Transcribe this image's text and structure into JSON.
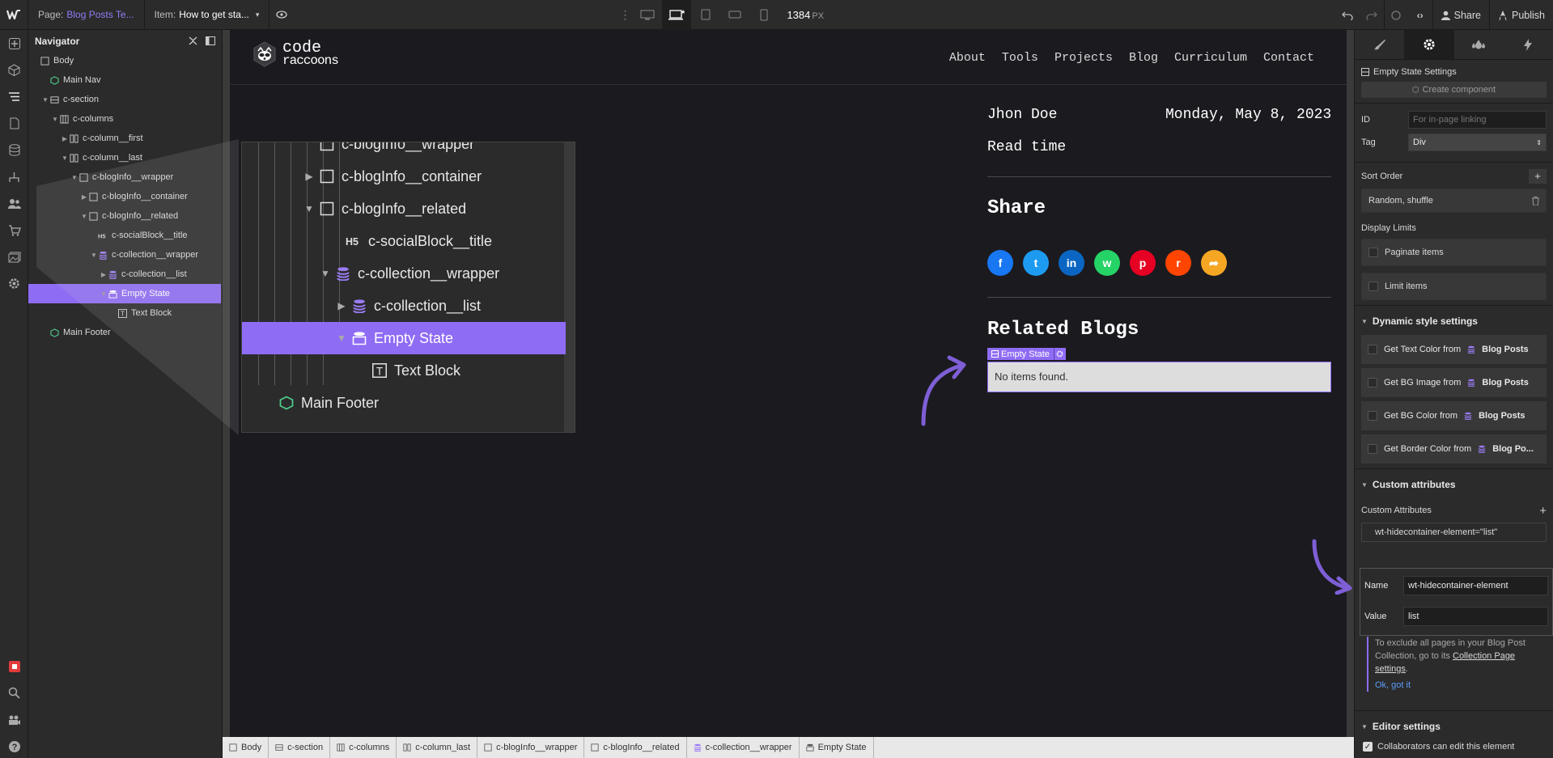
{
  "topbar": {
    "page_label": "Page:",
    "page_value": "Blog Posts Te...",
    "item_label": "Item:",
    "item_value": "How to get sta...",
    "canvas_width": "1384",
    "canvas_unit": "PX",
    "share_label": "Share",
    "publish_label": "Publish"
  },
  "navigator": {
    "title": "Navigator",
    "tree": [
      {
        "label": "Body",
        "icon": "box-icon"
      },
      {
        "label": "Main Nav",
        "icon": "component-icon"
      },
      {
        "label": "c-section",
        "icon": "section-icon"
      },
      {
        "label": "c-columns",
        "icon": "columns-icon"
      },
      {
        "label": "c-column__first",
        "icon": "column-icon"
      },
      {
        "label": "c-column__last",
        "icon": "column-icon"
      },
      {
        "label": "c-blogInfo__wrapper",
        "icon": "box-icon"
      },
      {
        "label": "c-blogInfo__container",
        "icon": "box-icon"
      },
      {
        "label": "c-blogInfo__related",
        "icon": "box-icon"
      },
      {
        "label": "c-socialBlock__title",
        "icon": "h5-icon"
      },
      {
        "label": "c-collection__wrapper",
        "icon": "collection-icon"
      },
      {
        "label": "c-collection__list",
        "icon": "collection-icon"
      },
      {
        "label": "Empty State",
        "icon": "empty-state-icon"
      },
      {
        "label": "Text Block",
        "icon": "text-block-icon"
      },
      {
        "label": "Main Footer",
        "icon": "component-icon"
      }
    ],
    "zoom_rows": [
      {
        "label": "c-blogInfo__wrapper"
      },
      {
        "label": "c-blogInfo__container"
      },
      {
        "label": "c-blogInfo__related"
      },
      {
        "label": "c-socialBlock__title"
      },
      {
        "label": "c-collection__wrapper"
      },
      {
        "label": "c-collection__list"
      },
      {
        "label": "Empty State"
      },
      {
        "label": "Text Block"
      },
      {
        "label": "Main Footer"
      }
    ]
  },
  "site": {
    "logo_top": "code",
    "logo_bottom": "raccoons",
    "links": [
      "About",
      "Tools",
      "Projects",
      "Blog",
      "Curriculum",
      "Contact"
    ],
    "author": "Jhon Doe",
    "date": "Monday, May 8, 2023",
    "read_time": "Read time",
    "share_title": "Share",
    "share_icons": [
      {
        "name": "facebook-icon",
        "glyph": "f",
        "color": "#1877f2"
      },
      {
        "name": "twitter-icon",
        "glyph": "t",
        "color": "#1d9bf0"
      },
      {
        "name": "linkedin-icon",
        "glyph": "in",
        "color": "#0a66c2"
      },
      {
        "name": "whatsapp-icon",
        "glyph": "w",
        "color": "#25d366"
      },
      {
        "name": "pinterest-icon",
        "glyph": "p",
        "color": "#e60023"
      },
      {
        "name": "reddit-icon",
        "glyph": "r",
        "color": "#ff4500"
      },
      {
        "name": "share-arrow-icon",
        "glyph": "➦",
        "color": "#f5a623"
      }
    ],
    "related_title": "Related Blogs",
    "empty_state_tag": "Empty State",
    "empty_state_text": "No items found."
  },
  "settings_panel": {
    "element_title": "Empty State Settings",
    "create_component": "Create component",
    "id_label": "ID",
    "id_placeholder": "For in-page linking",
    "tag_label": "Tag",
    "tag_value": "Div",
    "sort_order_label": "Sort Order",
    "sort_order_value": "Random, shuffle",
    "display_limits_label": "Display Limits",
    "paginate_label": "Paginate items",
    "limit_label": "Limit items",
    "dynamic_style_title": "Dynamic style settings",
    "dynamic_items": [
      {
        "prefix": "Get Text Color from",
        "source": "Blog Posts"
      },
      {
        "prefix": "Get BG Image from",
        "source": "Blog Posts"
      },
      {
        "prefix": "Get BG Color from",
        "source": "Blog Posts"
      },
      {
        "prefix": "Get Border Color from",
        "source": "Blog Po..."
      }
    ],
    "custom_attr_title": "Custom attributes",
    "custom_attr_label": "Custom Attributes",
    "attribute_summary": "wt-hidecontainer-element=\"list\"",
    "name_label": "Name",
    "name_value": "wt-hidecontainer-element",
    "value_label": "Value",
    "value_value": "list",
    "note_text_1": "To exclude all pages in your Blog Post Collection, go to its",
    "note_link": "Collection Page settings",
    "note_ok": "Ok, got it",
    "editor_settings_title": "Editor settings",
    "collab_label": "Collaborators can edit this element"
  },
  "breadcrumb": [
    {
      "label": "Body"
    },
    {
      "label": "c-section"
    },
    {
      "label": "c-columns"
    },
    {
      "label": "c-column_last"
    },
    {
      "label": "c-blogInfo__wrapper"
    },
    {
      "label": "c-blogInfo__related"
    },
    {
      "label": "c-collection__wrapper"
    },
    {
      "label": "Empty State"
    }
  ],
  "colors": {
    "accent": "#8f6cf4",
    "panel_bg": "#2b2b2b",
    "canvas_bg": "#1b1a1f"
  }
}
